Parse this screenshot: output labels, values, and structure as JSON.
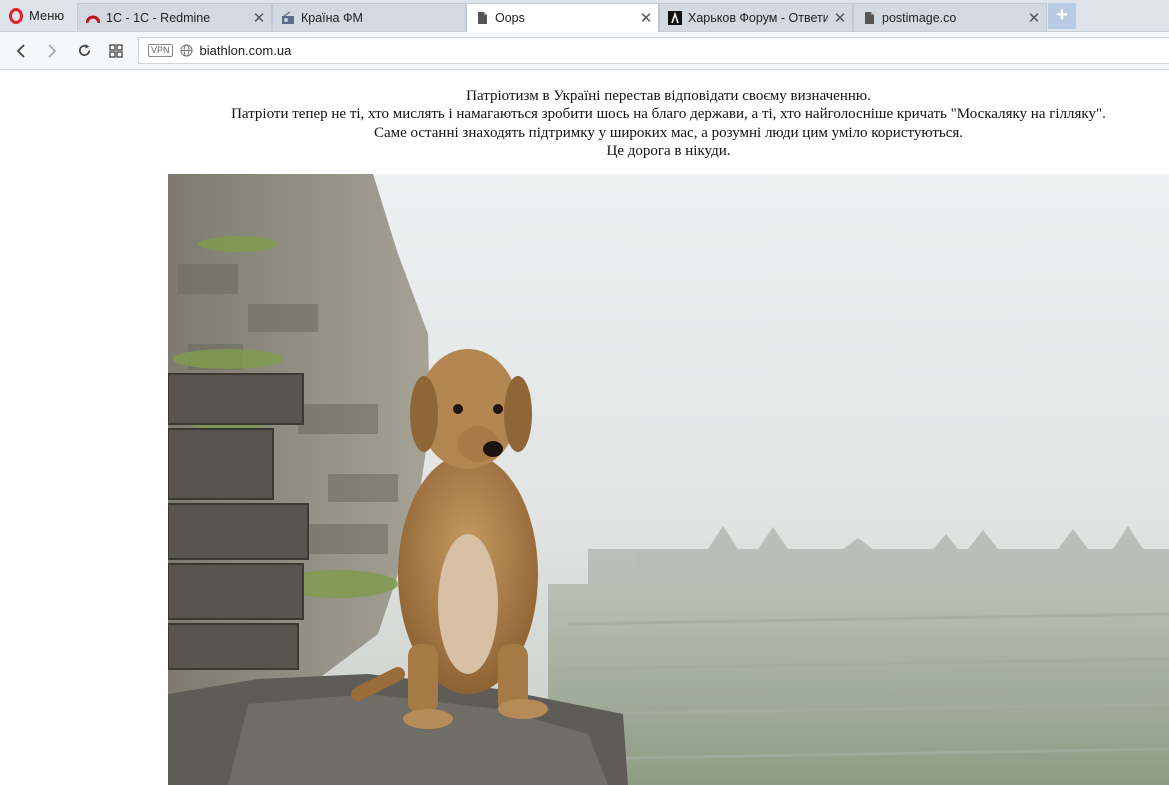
{
  "browser": {
    "menu_label": "Меню",
    "tabs": [
      {
        "title": "1С - 1С - Redmine",
        "icon": "redmine-icon",
        "active": false
      },
      {
        "title": "Країна ФМ",
        "icon": "radio-icon",
        "active": false
      },
      {
        "title": "Oops",
        "icon": "page-icon",
        "active": true
      },
      {
        "title": "Харьков Форум - Ответит",
        "icon": "forum-icon",
        "active": false
      },
      {
        "title": "postimage.co",
        "icon": "page-icon",
        "active": false
      }
    ],
    "new_tab_label": "+",
    "vpn_label": "VPN",
    "url": "biathlon.com.ua"
  },
  "page": {
    "lines": [
      "Патріотизм в Україні перестав відповідати своєму визначенню.",
      "Патріоти тепер не ті, хто мислять і намагаються зробити шось на благо держави, а ті, хто найголосніше кричать \"Москаляку на гілляку\".",
      "Саме останні знаходять підтримку у широких мас, а розумні люди цим уміло користуються.",
      "Це дорога в нікуди."
    ]
  },
  "colors": {
    "opera_red": "#e0242f",
    "new_tab_blue": "#b7cbe3"
  }
}
